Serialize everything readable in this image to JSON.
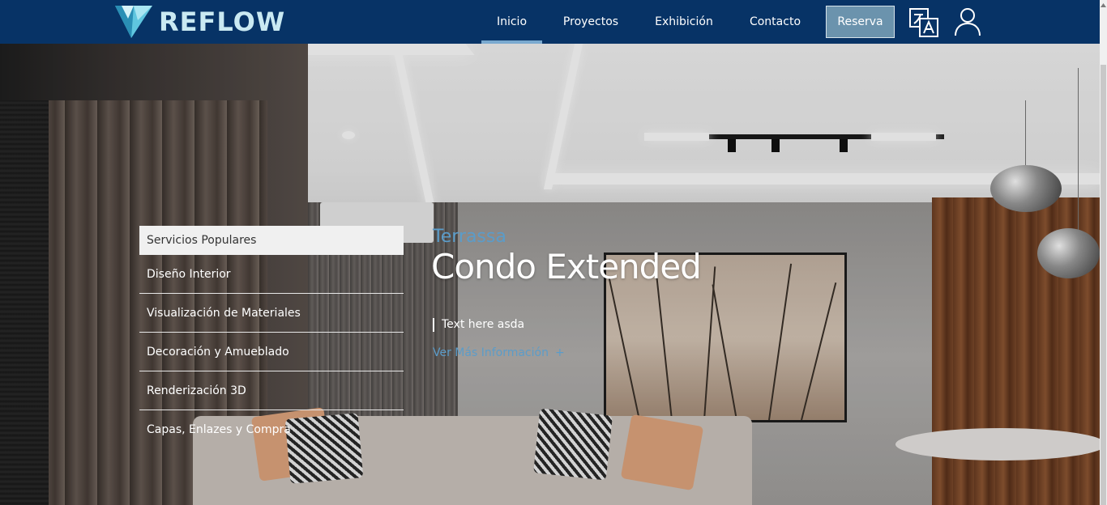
{
  "header": {
    "logo_text": "REFLOW",
    "nav": [
      {
        "label": "Inicio",
        "active": true
      },
      {
        "label": "Proyectos",
        "active": false
      },
      {
        "label": "Exhibición",
        "active": false
      },
      {
        "label": "Contacto",
        "active": false
      }
    ],
    "reserve_label": "Reserva",
    "icons": [
      "translate-icon",
      "user-icon"
    ]
  },
  "services": {
    "title": "Servicios Populares",
    "items": [
      "Diseño Interior",
      "Visualización de Materiales",
      "Decoración y Amueblado",
      "Renderización 3D",
      "Capas, Enlazes y Compra"
    ]
  },
  "hero": {
    "subtitle": "Terrassa",
    "title": "Condo Extended",
    "text": "Text here asda",
    "link_label": "Ver Más Información",
    "link_icon": "plus-icon"
  },
  "colors": {
    "header_bg": "#073366",
    "accent": "#5b9cc9",
    "reserve_bg": "#6b93ad",
    "logo": "#c9e9f2"
  }
}
